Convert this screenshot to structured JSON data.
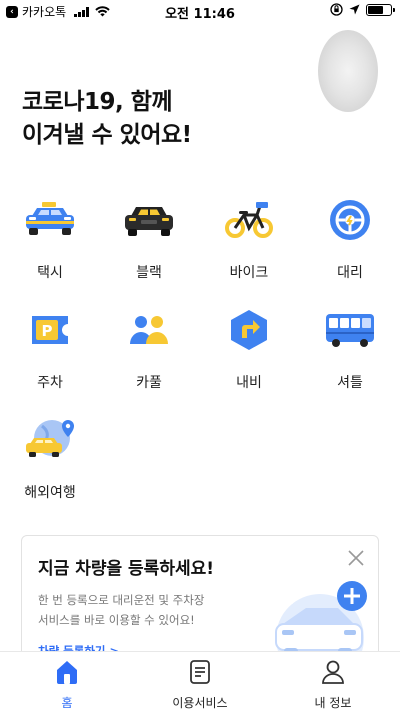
{
  "status_bar": {
    "back_app": "카카오톡",
    "time": "오전 11:46"
  },
  "header": {
    "headline_line1": "코로나19, 함께",
    "headline_line2": "이겨낼 수 있어요!"
  },
  "services": [
    {
      "label": "택시",
      "icon": "taxi-icon"
    },
    {
      "label": "블랙",
      "icon": "black-car-icon"
    },
    {
      "label": "바이크",
      "icon": "bike-icon"
    },
    {
      "label": "대리",
      "icon": "steering-wheel-icon"
    },
    {
      "label": "주차",
      "icon": "parking-ticket-icon"
    },
    {
      "label": "카풀",
      "icon": "carpool-people-icon"
    },
    {
      "label": "내비",
      "icon": "navigation-icon"
    },
    {
      "label": "셔틀",
      "icon": "shuttle-bus-icon"
    },
    {
      "label": "해외여행",
      "icon": "overseas-taxi-icon"
    }
  ],
  "promo_card": {
    "title": "지금 차량을 등록하세요!",
    "desc_line1": "한 번 등록으로 대리운전 및 주차장",
    "desc_line2": "서비스를 바로 이용할 수 있어요!",
    "link": "차량 등록하기 >"
  },
  "tabbar": {
    "home": "홈",
    "services": "이용서비스",
    "my_info": "내 정보"
  },
  "colors": {
    "accent_blue": "#2f6df6",
    "taxi_yellow": "#f7c833",
    "icon_blue": "#3f82f0"
  }
}
